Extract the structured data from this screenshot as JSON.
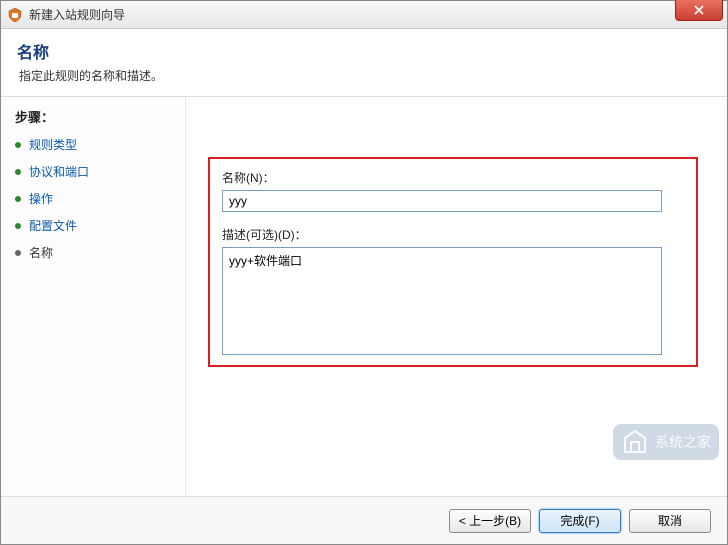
{
  "window": {
    "title": "新建入站规则向导"
  },
  "header": {
    "title": "名称",
    "subtitle": "指定此规则的名称和描述。"
  },
  "sidebar": {
    "heading": "步骤：",
    "steps": [
      {
        "label": "规则类型",
        "current": false
      },
      {
        "label": "协议和端口",
        "current": false
      },
      {
        "label": "操作",
        "current": false
      },
      {
        "label": "配置文件",
        "current": false
      },
      {
        "label": "名称",
        "current": true
      }
    ]
  },
  "form": {
    "name_label": "名称(N)：",
    "name_value": "yyy",
    "desc_label": "描述(可选)(D)：",
    "desc_value": "yyy+软件端口"
  },
  "buttons": {
    "back": "< 上一步(B)",
    "finish": "完成(F)",
    "cancel": "取消"
  },
  "watermark": {
    "text": "系统之家"
  }
}
